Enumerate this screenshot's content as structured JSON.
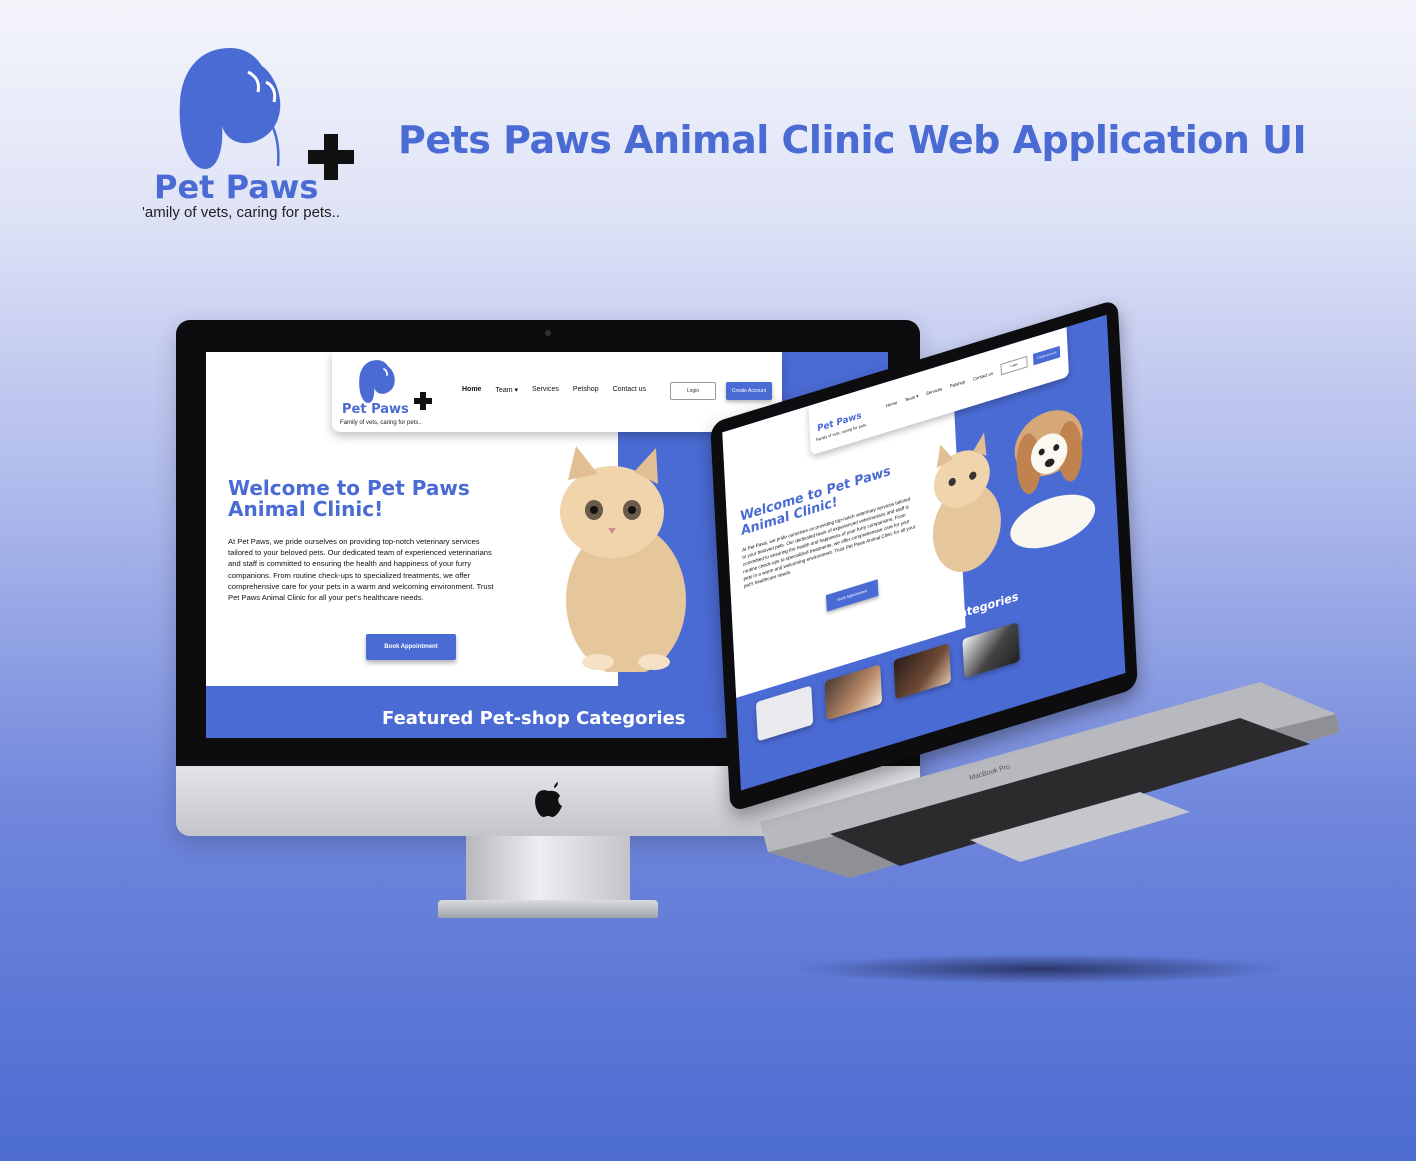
{
  "header": {
    "logo_word": "Pet Paws",
    "logo_tagline": "'amily of vets, caring for pets..",
    "title": "Pets Paws Animal Clinic Web Application UI"
  },
  "site": {
    "logo_word": "Pet Paws",
    "logo_tagline": "Family of vets, caring for pets..",
    "nav": [
      {
        "label": "Home",
        "active": true
      },
      {
        "label": "Team ▾",
        "active": false
      },
      {
        "label": "Services",
        "active": false
      },
      {
        "label": "Petshop",
        "active": false
      },
      {
        "label": "Contact us",
        "active": false
      }
    ],
    "login_label": "Login",
    "create_account_label": "Create Account",
    "hero_heading": "Welcome to Pet Paws Animal Clinic!",
    "hero_text": "At Pet Paws, we pride ourselves on providing top-notch veterinary services tailored to your beloved pets. Our dedicated team of experienced veterinarians and staff is committed to ensuring the health and happiness of your furry companions. From routine check-ups to specialized treatments, we offer comprehensive care for your pets in a warm and welcoming environment. Trust Pet Paws Animal Clinic for all your pet's healthcare needs.",
    "book_label": "Book Appointment",
    "featured_title": "Featured Pet-shop Categories"
  },
  "laptop": {
    "brand_label": "MacBook Pro"
  },
  "colors": {
    "brand_blue": "#4b6bd4",
    "plus_black": "#111111"
  }
}
